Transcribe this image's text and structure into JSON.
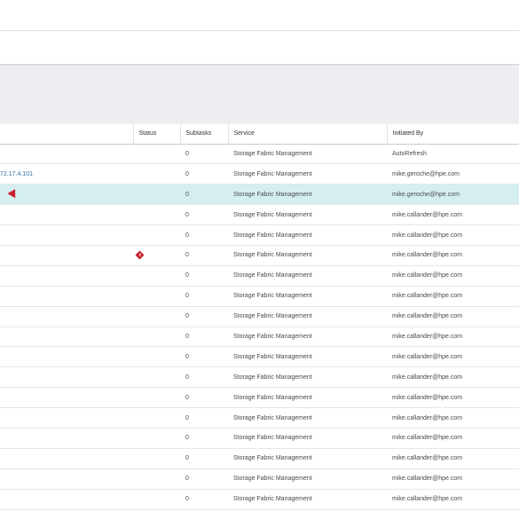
{
  "table": {
    "columns": [
      "",
      "Status",
      "Subtasks",
      "Service",
      "Initiated By"
    ],
    "rows": [
      {
        "name": "",
        "status": "",
        "subtasks": "0",
        "service": "Storage Fabric Management",
        "initiated_by": "AutoRefresh"
      },
      {
        "name": "72.17.4.101",
        "status": "",
        "subtasks": "0",
        "service": "Storage Fabric Management",
        "initiated_by": "mike.geroche@hpe.com"
      },
      {
        "name": "",
        "status": "",
        "subtasks": "0",
        "service": "Storage Fabric Management",
        "initiated_by": "mike.geroche@hpe.com",
        "selected": true
      },
      {
        "name": "",
        "status": "",
        "subtasks": "0",
        "service": "Storage Fabric Management",
        "initiated_by": "mike.callander@hpe.com"
      },
      {
        "name": "",
        "status": "",
        "subtasks": "0",
        "service": "Storage Fabric Management",
        "initiated_by": "mike.callander@hpe.com"
      },
      {
        "name": "",
        "status": "warning",
        "subtasks": "0",
        "service": "Storage Fabric Management",
        "initiated_by": "mike.callander@hpe.com"
      },
      {
        "name": "",
        "status": "",
        "subtasks": "0",
        "service": "Storage Fabric Management",
        "initiated_by": "mike.callander@hpe.com"
      },
      {
        "name": "",
        "status": "",
        "subtasks": "0",
        "service": "Storage Fabric Management",
        "initiated_by": "mike.callander@hpe.com"
      },
      {
        "name": "",
        "status": "",
        "subtasks": "0",
        "service": "Storage Fabric Management",
        "initiated_by": "mike.callander@hpe.com"
      },
      {
        "name": "",
        "status": "",
        "subtasks": "0",
        "service": "Storage Fabric Management",
        "initiated_by": "mike.callander@hpe.com"
      },
      {
        "name": "",
        "status": "",
        "subtasks": "0",
        "service": "Storage Fabric Management",
        "initiated_by": "mike.callander@hpe.com"
      },
      {
        "name": "",
        "status": "",
        "subtasks": "0",
        "service": "Storage Fabric Management",
        "initiated_by": "mike.callander@hpe.com"
      },
      {
        "name": "",
        "status": "",
        "subtasks": "0",
        "service": "Storage Fabric Management",
        "initiated_by": "mike.callander@hpe.com"
      },
      {
        "name": "",
        "status": "",
        "subtasks": "0",
        "service": "Storage Fabric Management",
        "initiated_by": "mike.callander@hpe.com"
      },
      {
        "name": "",
        "status": "",
        "subtasks": "0",
        "service": "Storage Fabric Management",
        "initiated_by": "mike.callander@hpe.com"
      },
      {
        "name": "",
        "status": "",
        "subtasks": "0",
        "service": "Storage Fabric Management",
        "initiated_by": "mike.callander@hpe.com"
      },
      {
        "name": "",
        "status": "",
        "subtasks": "0",
        "service": "Storage Fabric Management",
        "initiated_by": "mike.callander@hpe.com"
      },
      {
        "name": "",
        "status": "",
        "subtasks": "0",
        "service": "Storage Fabric Management",
        "initiated_by": "mike.callander@hpe.com"
      }
    ]
  },
  "colors": {
    "selected_row": "#d5eff1",
    "warning": "#c8202f",
    "link": "#2b6fa8",
    "banner": "#eceef1"
  }
}
